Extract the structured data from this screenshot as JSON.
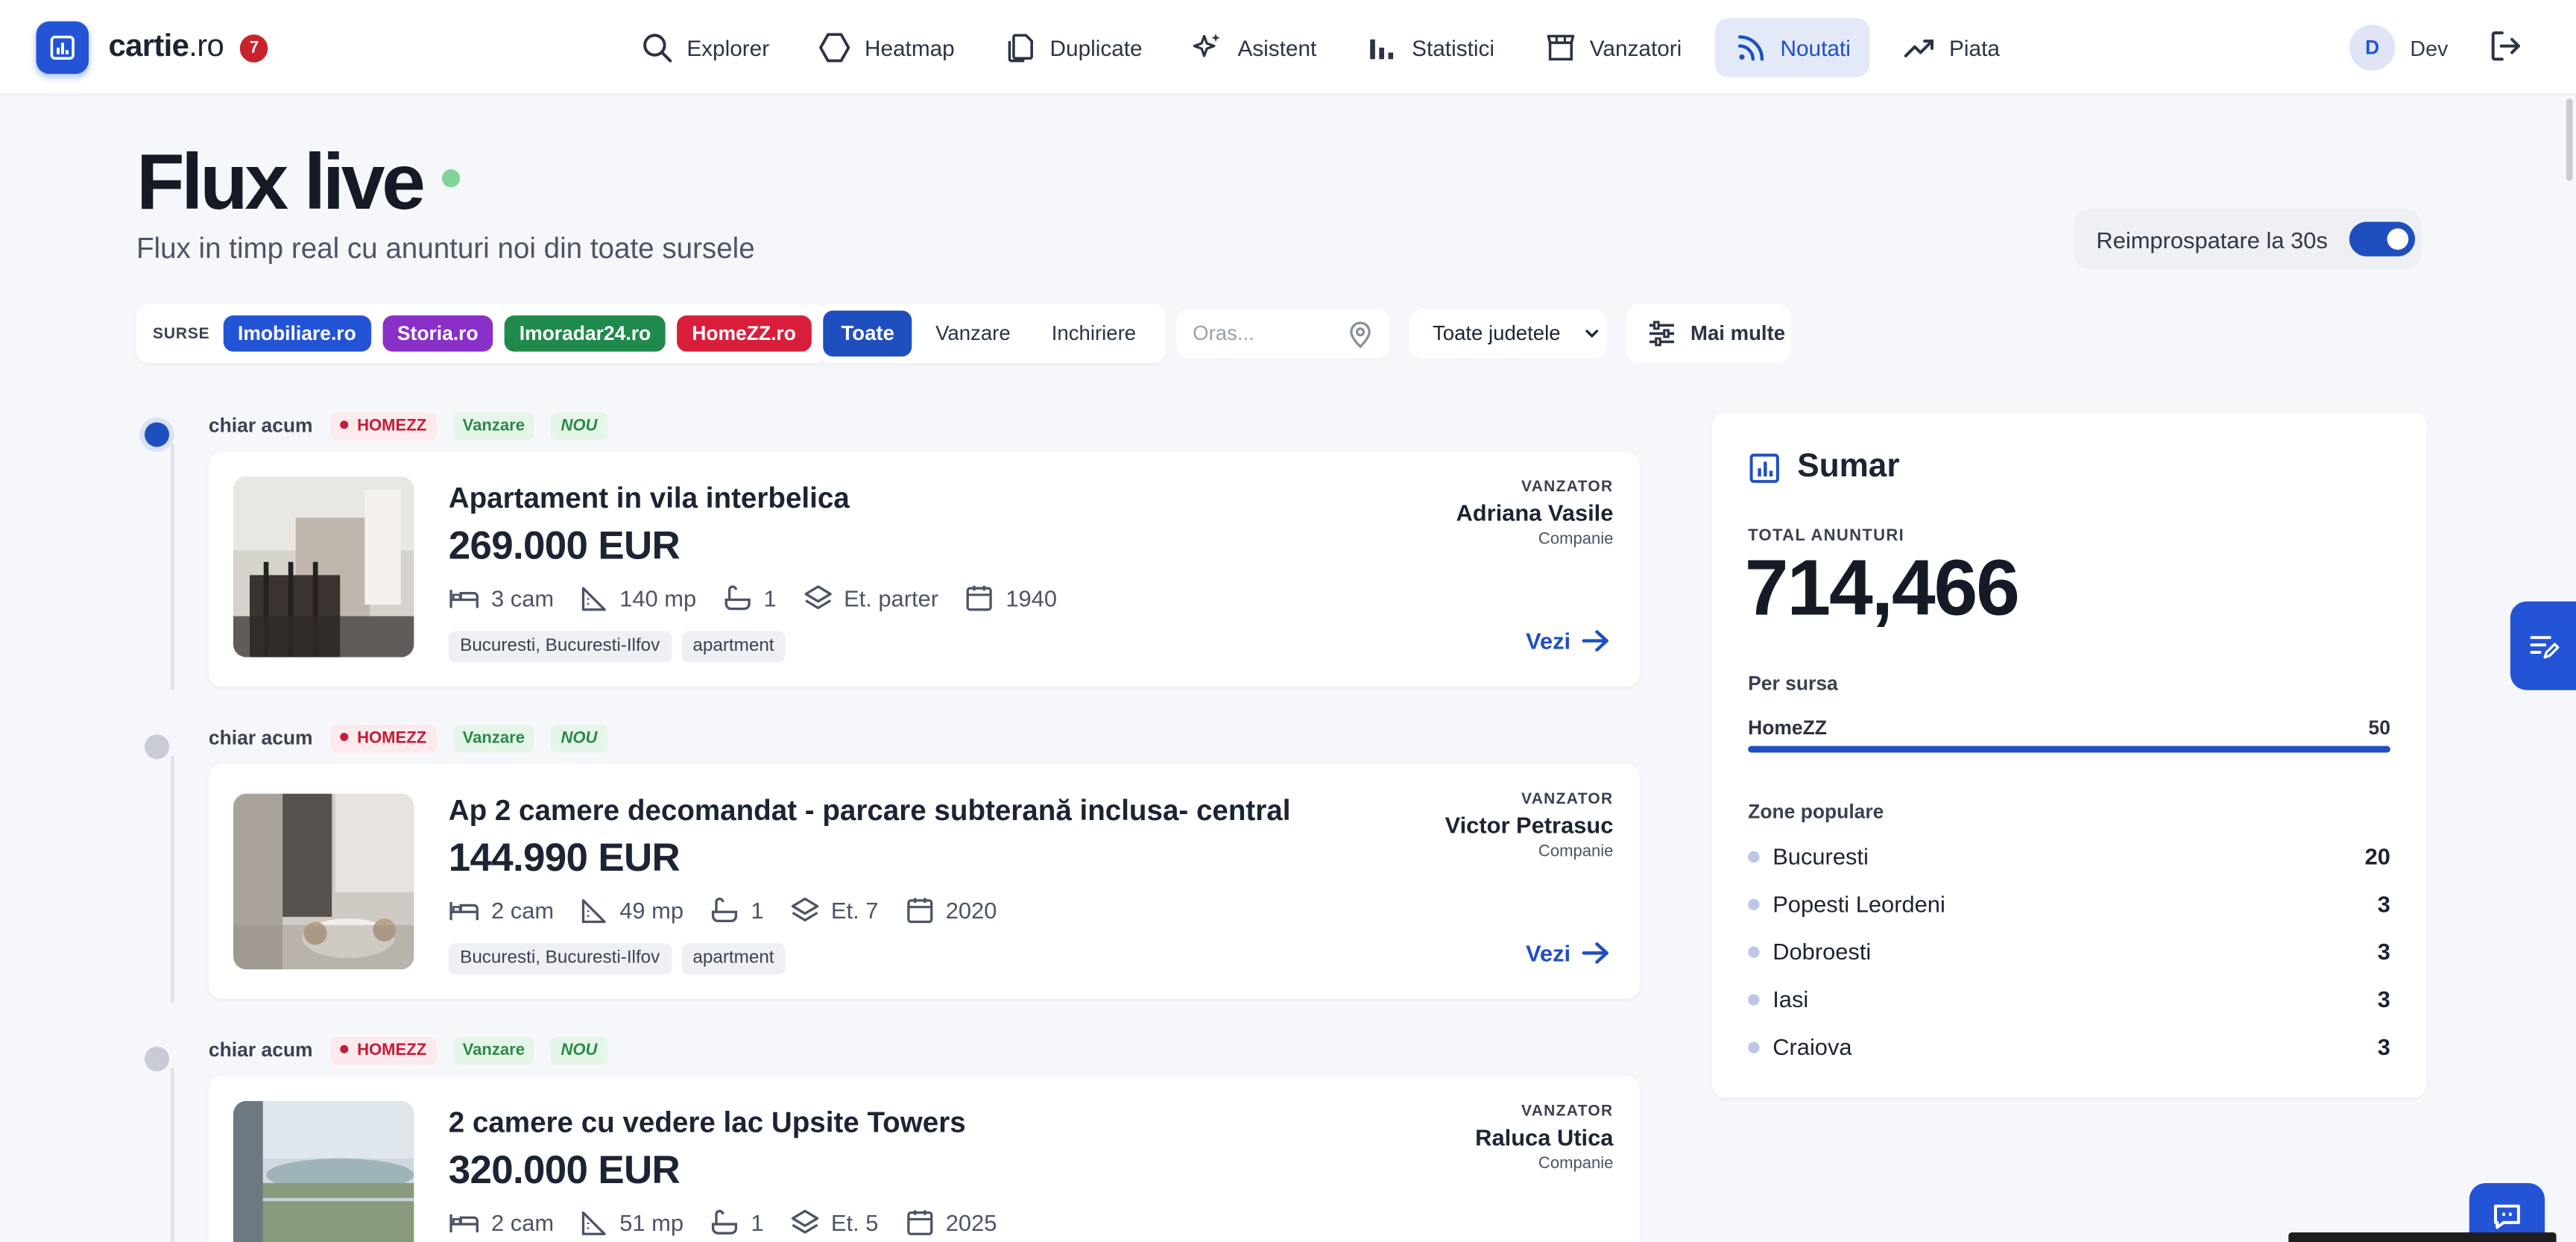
{
  "app": {
    "name": "cartie",
    "tld": ".ro",
    "notifications": "7"
  },
  "nav": [
    {
      "label": "Explorer",
      "icon": "search-icon"
    },
    {
      "label": "Heatmap",
      "icon": "hexagon-icon"
    },
    {
      "label": "Duplicate",
      "icon": "copy-icon"
    },
    {
      "label": "Asistent",
      "icon": "sparkles-icon"
    },
    {
      "label": "Statistici",
      "icon": "bar-chart-icon"
    },
    {
      "label": "Vanzatori",
      "icon": "store-icon"
    },
    {
      "label": "Noutati",
      "icon": "rss-icon",
      "active": true
    },
    {
      "label": "Piata",
      "icon": "trending-up-icon"
    }
  ],
  "user": {
    "initial": "D",
    "name": "Dev"
  },
  "header": {
    "title": "Flux live",
    "subtitle": "Flux in timp real cu anunturi noi din toate sursele",
    "refresh_label": "Reimprospatare la 30s",
    "refresh_on": true
  },
  "filters": {
    "sources_label": "SURSE",
    "sources": [
      {
        "label": "Imobiliare.ro",
        "color": "#2454d6"
      },
      {
        "label": "Storia.ro",
        "color": "#8a2fc7"
      },
      {
        "label": "Imoradar24.ro",
        "color": "#1f8a4c"
      },
      {
        "label": "HomeZZ.ro",
        "color": "#d81e3b"
      }
    ],
    "deal_types": [
      "Toate",
      "Vanzare",
      "Inchiriere"
    ],
    "deal_selected": "Toate",
    "city_placeholder": "Oras...",
    "county_value": "Toate judetele",
    "more_label": "Mai multe"
  },
  "feed": [
    {
      "when": "chiar acum",
      "source": "HOMEZZ",
      "deal": "Vanzare",
      "badge": "NOU",
      "title": "Apartament in vila interbelica",
      "price": "269.000 EUR",
      "rooms": "3 cam",
      "area": "140 mp",
      "baths": "1",
      "floor": "Et. parter",
      "year": "1940",
      "location": "Bucuresti, Bucuresti-Ilfov",
      "type": "apartment",
      "seller_label": "VANZATOR",
      "seller": "Adriana Vasile",
      "seller_type": "Companie",
      "view_label": "Vezi"
    },
    {
      "when": "chiar acum",
      "source": "HOMEZZ",
      "deal": "Vanzare",
      "badge": "NOU",
      "title": "Ap 2 camere decomandat - parcare subterană inclusa- central",
      "price": "144.990 EUR",
      "rooms": "2 cam",
      "area": "49 mp",
      "baths": "1",
      "floor": "Et. 7",
      "year": "2020",
      "location": "Bucuresti, Bucuresti-Ilfov",
      "type": "apartment",
      "seller_label": "VANZATOR",
      "seller": "Victor Petrasuc",
      "seller_type": "Companie",
      "view_label": "Vezi"
    },
    {
      "when": "chiar acum",
      "source": "HOMEZZ",
      "deal": "Vanzare",
      "badge": "NOU",
      "title": "2 camere cu vedere lac Upsite Towers",
      "price": "320.000 EUR",
      "rooms": "2 cam",
      "area": "51 mp",
      "baths": "1",
      "floor": "Et. 5",
      "year": "2025",
      "seller_label": "VANZATOR",
      "seller": "Raluca Utica",
      "seller_type": "Companie"
    }
  ],
  "summary": {
    "title": "Sumar",
    "total_label": "TOTAL ANUNTURI",
    "total": "714,466",
    "per_source_label": "Per sursa",
    "per_source": [
      {
        "name": "HomeZZ",
        "count": "50",
        "fraction": 1.0
      }
    ],
    "zones_label": "Zone populare",
    "zones": [
      {
        "name": "Bucuresti",
        "count": "20"
      },
      {
        "name": "Popesti Leordeni",
        "count": "3"
      },
      {
        "name": "Dobroesti",
        "count": "3"
      },
      {
        "name": "Iasi",
        "count": "3"
      },
      {
        "name": "Craiova",
        "count": "3"
      }
    ]
  }
}
